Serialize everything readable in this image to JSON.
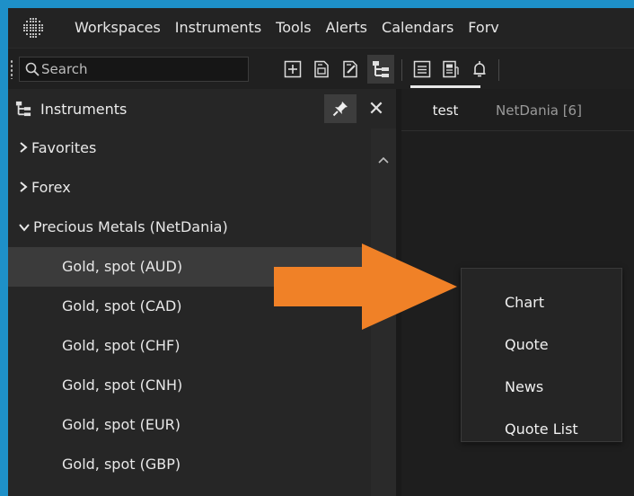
{
  "menu": {
    "items": [
      "Workspaces",
      "Instruments",
      "Tools",
      "Alerts",
      "Calendars",
      "Forv"
    ]
  },
  "toolbar": {
    "search_placeholder": "Search"
  },
  "instruments_panel": {
    "title": "Instruments",
    "close_glyph": "✕",
    "groups": [
      {
        "label": "Favorites",
        "expanded": false
      },
      {
        "label": "Forex",
        "expanded": false
      },
      {
        "label": "Precious Metals (NetDania)",
        "expanded": true
      }
    ],
    "items": [
      {
        "label": "Gold, spot (AUD)",
        "selected": true
      },
      {
        "label": "Gold, spot (CAD)",
        "selected": false
      },
      {
        "label": "Gold, spot (CHF)",
        "selected": false
      },
      {
        "label": "Gold, spot (CNH)",
        "selected": false
      },
      {
        "label": "Gold, spot (EUR)",
        "selected": false
      },
      {
        "label": "Gold, spot (GBP)",
        "selected": false
      }
    ]
  },
  "tabs": [
    {
      "label": "test",
      "active": true
    },
    {
      "label": "NetDania [6]",
      "active": false
    }
  ],
  "context_menu": {
    "items": [
      "Chart",
      "Quote",
      "News",
      "Quote List"
    ]
  },
  "colors": {
    "frame": "#1e90c8",
    "arrow": "#f08127",
    "selection": "#3b3b3b",
    "panel": "#262626"
  }
}
